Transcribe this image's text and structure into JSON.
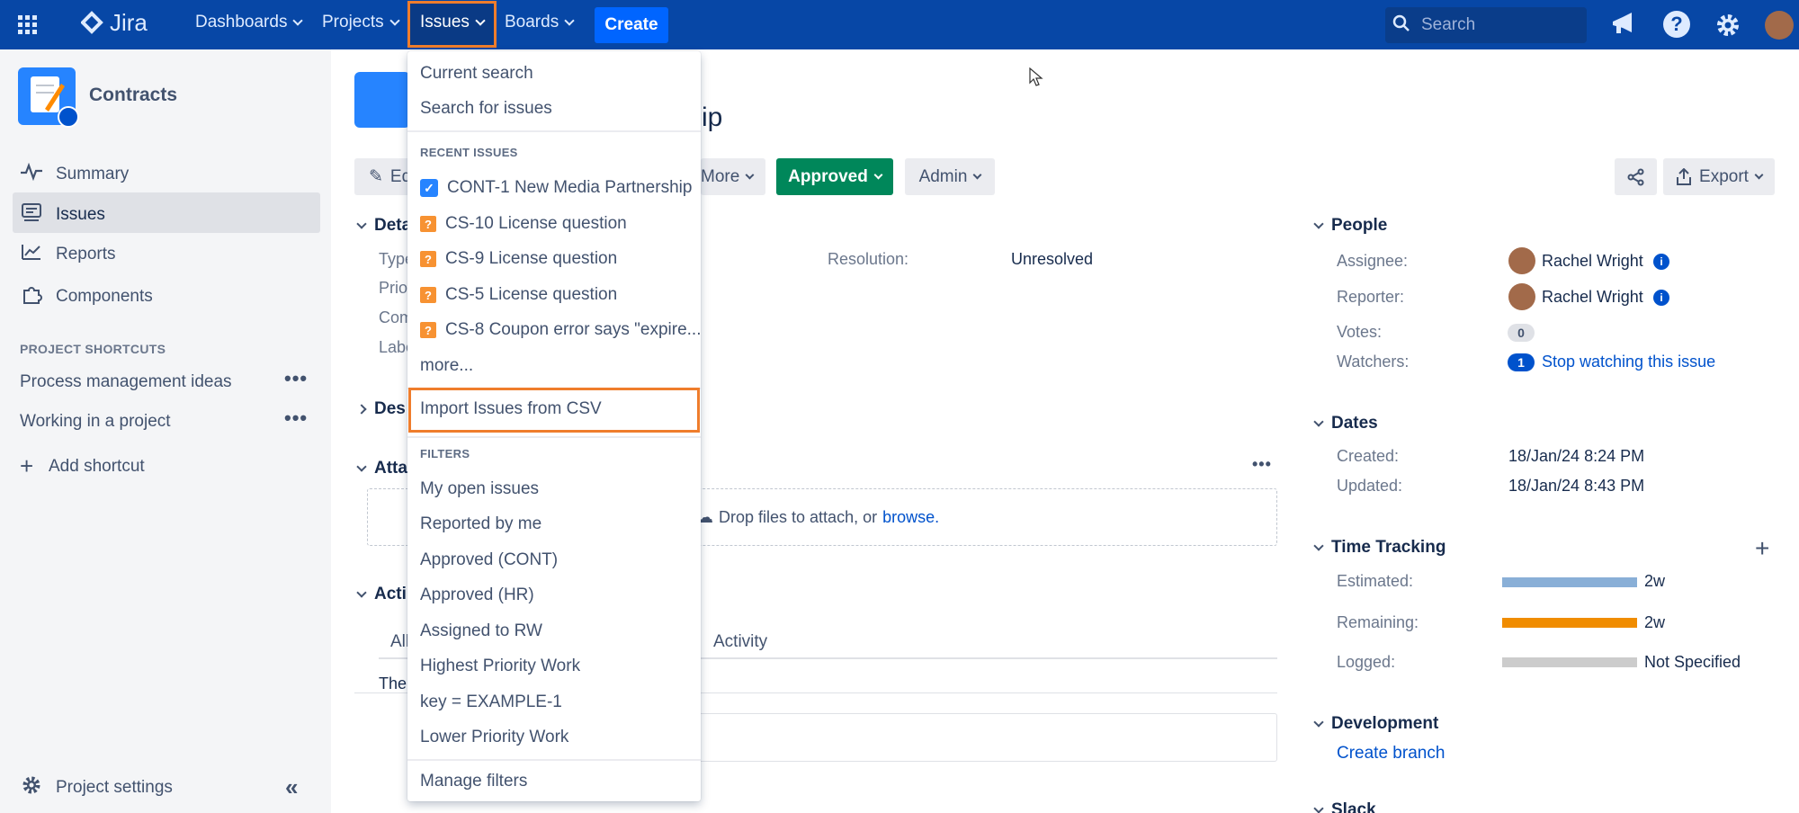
{
  "nav": {
    "logo": "Jira",
    "dashboards": "Dashboards",
    "projects": "Projects",
    "issues": "Issues",
    "boards": "Boards",
    "create": "Create",
    "search_placeholder": "Search"
  },
  "sidebar": {
    "project_name": "Contracts",
    "items": [
      {
        "label": "Summary",
        "icon": "activity-icon"
      },
      {
        "label": "Issues",
        "icon": "issues-icon"
      },
      {
        "label": "Reports",
        "icon": "reports-icon"
      },
      {
        "label": "Components",
        "icon": "components-icon"
      }
    ],
    "shortcuts_header": "PROJECT SHORTCUTS",
    "shortcuts": [
      "Process management ideas",
      "Working in a project"
    ],
    "add_shortcut": "Add shortcut",
    "project_settings": "Project settings"
  },
  "issue": {
    "title_fragment": "ip",
    "edit_fragment": "Ed",
    "more": "More",
    "status": "Approved",
    "admin": "Admin",
    "export": "Export",
    "details_fragment": "Deta",
    "type_fragment": "Type",
    "priority_fragment": "Prio",
    "component_fragment": "Com",
    "labels_fragment": "Labe",
    "resolution_label": "Resolution:",
    "resolution_value": "Unresolved",
    "description_fragment": "Des",
    "attachments_fragment": "Atta",
    "drop_text": "Drop files to attach, or",
    "browse": "browse.",
    "activity_fragment": "Acti",
    "tab_all_fragment": "All",
    "tab_activity": "Activity",
    "there_fragment": "Ther"
  },
  "people": {
    "header": "People",
    "assignee_label": "Assignee:",
    "assignee": "Rachel Wright",
    "reporter_label": "Reporter:",
    "reporter": "Rachel Wright",
    "votes_label": "Votes:",
    "votes": "0",
    "watchers_label": "Watchers:",
    "watchers_count": "1",
    "watch_link": "Stop watching this issue"
  },
  "dates": {
    "header": "Dates",
    "created_label": "Created:",
    "created": "18/Jan/24 8:24 PM",
    "updated_label": "Updated:",
    "updated": "18/Jan/24 8:43 PM"
  },
  "time_tracking": {
    "header": "Time Tracking",
    "estimated_label": "Estimated:",
    "estimated": "2w",
    "estimated_fill": 1.0,
    "remaining_label": "Remaining:",
    "remaining": "2w",
    "remaining_fill": 1.0,
    "logged_label": "Logged:",
    "logged": "Not Specified",
    "logged_fill": 0.0,
    "colors": {
      "estimated": "#89afd7",
      "remaining": "#f08c00",
      "logged": "#cccccc"
    }
  },
  "development": {
    "header": "Development",
    "create_branch": "Create branch"
  },
  "slack_fragment": "Slack",
  "dropdown": {
    "current_search": "Current search",
    "search_for_issues": "Search for issues",
    "recent_header": "RECENT ISSUES",
    "recent": [
      {
        "text": "CONT-1 New Media Partnership",
        "icon": "checkbox-icon"
      },
      {
        "text": "CS-10 License question",
        "icon": "question-icon"
      },
      {
        "text": "CS-9 License question",
        "icon": "question-icon"
      },
      {
        "text": "CS-5 License question",
        "icon": "question-icon"
      },
      {
        "text": "CS-8 Coupon error says \"expire...",
        "icon": "question-icon"
      }
    ],
    "more": "more...",
    "import_csv": "Import Issues from CSV",
    "filters_header": "FILTERS",
    "filters": [
      "My open issues",
      "Reported by me",
      "Approved (CONT)",
      "Approved (HR)",
      "Assigned to RW",
      "Highest Priority Work",
      "key = EXAMPLE-1",
      "Lower Priority Work"
    ],
    "manage_filters": "Manage filters"
  },
  "colors": {
    "nav": "#0747a6",
    "create": "#0065ff",
    "approved": "#00875a",
    "highlight": "#ef7d2c",
    "link": "#0052cc"
  }
}
